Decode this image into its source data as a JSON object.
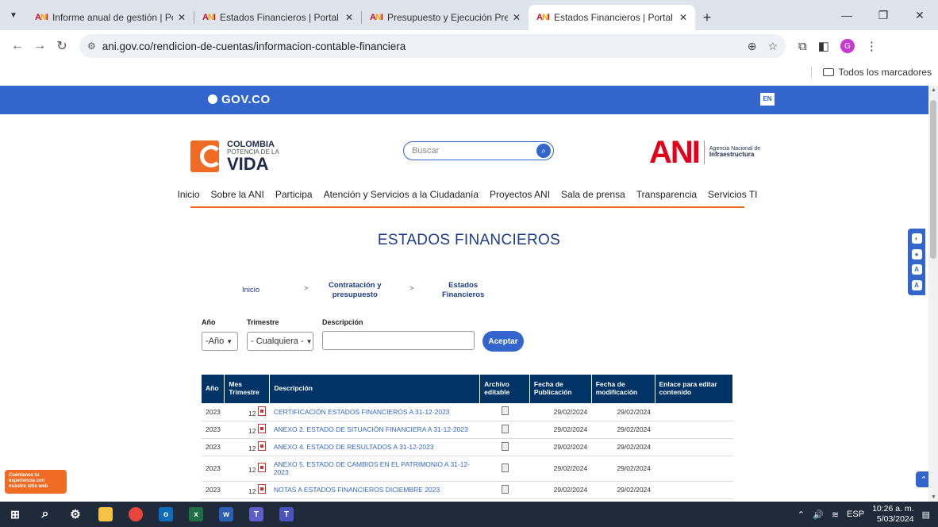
{
  "browser": {
    "tabs": [
      {
        "title": "Informe anual de gestión | Portal",
        "active": false
      },
      {
        "title": "Estados Financieros | Portal ANI",
        "active": false
      },
      {
        "title": "Presupuesto y Ejecución Presup",
        "active": false
      },
      {
        "title": "Estados Financieros | Portal ANI",
        "active": true
      }
    ],
    "url": "ani.gov.co/rendicion-de-cuentas/informacion-contable-financiera",
    "bookmarks_label": "Todos los marcadores",
    "profile_initial": "G"
  },
  "gov": {
    "brand": "GOV.CO",
    "lang": "EN"
  },
  "header": {
    "logo_l1": "COLOMBIA",
    "logo_l2": "POTENCIA DE LA",
    "logo_l3": "VIDA",
    "search_placeholder": "Buscar",
    "ani_word": "ANI",
    "ani_name_l1": "Agencia Nacional de",
    "ani_name_l2": "Infraestructura"
  },
  "nav": [
    "Inicio",
    "Sobre la ANI",
    "Participa",
    "Atención y Servicios a la Ciudadanía",
    "Proyectos ANI",
    "Sala de prensa",
    "Transparencia",
    "Servicios TI"
  ],
  "page": {
    "title": "ESTADOS FINANCIEROS",
    "breadcrumb": {
      "home": "Inicio",
      "sep": ">",
      "mid_l1": "Contratación y",
      "mid_l2": "presupuesto",
      "last_l1": "Estados",
      "last_l2": "Financieros"
    }
  },
  "filters": {
    "year_label": "Año",
    "year_value": "-Año",
    "quarter_label": "Trimestre",
    "quarter_value": "- Cualquiera -",
    "desc_label": "Descripción",
    "submit": "Aceptar"
  },
  "table": {
    "headers": {
      "year": "Año",
      "month_l1": "Mes",
      "month_l2": "Trimestre",
      "desc": "Descripción",
      "file_l1": "Archivo",
      "file_l2": "editable",
      "pub_l1": "Fecha de",
      "pub_l2": "Publicación",
      "mod_l1": "Fecha de",
      "mod_l2": "modificación",
      "link_l1": "Enlace para editar",
      "link_l2": "contenido"
    },
    "rows": [
      {
        "year": "2023",
        "month": "12",
        "desc": "CERTIFICACIÓN ESTADOS FINANCIEROS A 31-12-2023",
        "pub": "29/02/2024",
        "mod": "29/02/2024"
      },
      {
        "year": "2023",
        "month": "12",
        "desc": "ANEXO 2. ESTADO DE SITUACIÓN FINANCIERA A 31-12-2023",
        "pub": "29/02/2024",
        "mod": "29/02/2024"
      },
      {
        "year": "2023",
        "month": "12",
        "desc": "ANEXO 4. ESTADO DE RESULTADOS A 31-12-2023",
        "pub": "29/02/2024",
        "mod": "29/02/2024"
      },
      {
        "year": "2023",
        "month": "12",
        "desc": "ANEXO 5. ESTADO DE CAMBIOS EN EL PATRIMONIO A 31-12-2023",
        "pub": "29/02/2024",
        "mod": "29/02/2024"
      },
      {
        "year": "2023",
        "month": "12",
        "desc": "NOTAS A ESTADOS FINANCIEROS DICIEMBRE 2023",
        "pub": "29/02/2024",
        "mod": "29/02/2024"
      }
    ]
  },
  "feedback": "Cuéntanos tu experiencia con nuestro sitio web",
  "taskbar": {
    "lang": "ESP",
    "time": "10:26 a. m.",
    "date": "5/03/2024"
  },
  "colors": {
    "gov_blue": "#3366cc",
    "orange": "#f06b23",
    "table_header": "#003366",
    "ani_red": "#e3001b"
  }
}
